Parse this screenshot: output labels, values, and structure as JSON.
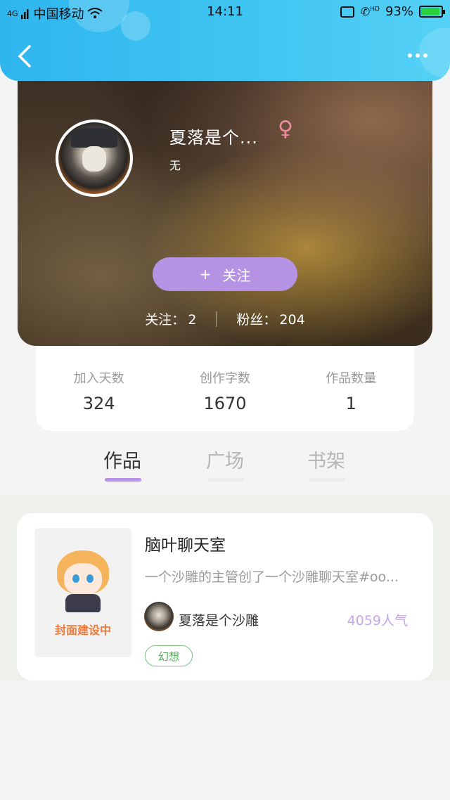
{
  "status_bar": {
    "signal_label": "4G",
    "carrier": "中国移动",
    "time": "14:11",
    "hd_label": "HD",
    "battery_percent": "93%",
    "battery_level": 0.93
  },
  "profile": {
    "username": "夏落是个...",
    "gender_symbol": "♀",
    "bio": "无",
    "follow_button": {
      "icon": "+",
      "label": "关注"
    },
    "following_label": "关注：",
    "following_count": "2",
    "fans_label": "粉丝：",
    "fans_count": "204"
  },
  "stats": [
    {
      "label": "加入天数",
      "value": "324"
    },
    {
      "label": "创作字数",
      "value": "1670"
    },
    {
      "label": "作品数量",
      "value": "1"
    }
  ],
  "tabs": [
    {
      "label": "作品",
      "active": true
    },
    {
      "label": "广场",
      "active": false
    },
    {
      "label": "书架",
      "active": false
    }
  ],
  "works": [
    {
      "cover_text": "封面建设中",
      "title": "脑叶聊天室",
      "description": "一个沙雕的主管创了一个沙雕聊天室#oo...",
      "author": "夏落是个沙雕",
      "popularity": "4059人气",
      "tag": "幻想"
    }
  ],
  "colors": {
    "header_gradient_start": "#2fb6ef",
    "accent_purple": "#b592e4",
    "popularity_purple": "#c5a7e8",
    "tag_green": "#7dc281",
    "gender_pink": "#f08ca0"
  }
}
